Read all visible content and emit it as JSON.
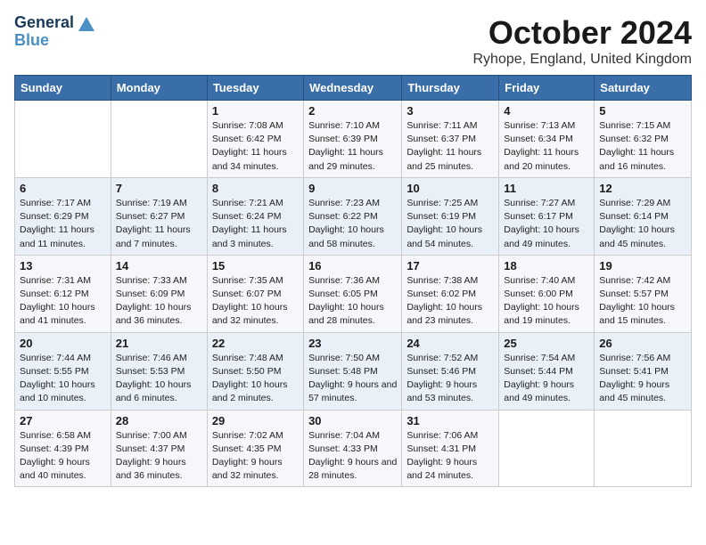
{
  "logo": {
    "line1": "General",
    "line2": "Blue"
  },
  "title": "October 2024",
  "location": "Ryhope, England, United Kingdom",
  "days_of_week": [
    "Sunday",
    "Monday",
    "Tuesday",
    "Wednesday",
    "Thursday",
    "Friday",
    "Saturday"
  ],
  "weeks": [
    [
      {
        "day": "",
        "info": ""
      },
      {
        "day": "",
        "info": ""
      },
      {
        "day": "1",
        "info": "Sunrise: 7:08 AM\nSunset: 6:42 PM\nDaylight: 11 hours and 34 minutes."
      },
      {
        "day": "2",
        "info": "Sunrise: 7:10 AM\nSunset: 6:39 PM\nDaylight: 11 hours and 29 minutes."
      },
      {
        "day": "3",
        "info": "Sunrise: 7:11 AM\nSunset: 6:37 PM\nDaylight: 11 hours and 25 minutes."
      },
      {
        "day": "4",
        "info": "Sunrise: 7:13 AM\nSunset: 6:34 PM\nDaylight: 11 hours and 20 minutes."
      },
      {
        "day": "5",
        "info": "Sunrise: 7:15 AM\nSunset: 6:32 PM\nDaylight: 11 hours and 16 minutes."
      }
    ],
    [
      {
        "day": "6",
        "info": "Sunrise: 7:17 AM\nSunset: 6:29 PM\nDaylight: 11 hours and 11 minutes."
      },
      {
        "day": "7",
        "info": "Sunrise: 7:19 AM\nSunset: 6:27 PM\nDaylight: 11 hours and 7 minutes."
      },
      {
        "day": "8",
        "info": "Sunrise: 7:21 AM\nSunset: 6:24 PM\nDaylight: 11 hours and 3 minutes."
      },
      {
        "day": "9",
        "info": "Sunrise: 7:23 AM\nSunset: 6:22 PM\nDaylight: 10 hours and 58 minutes."
      },
      {
        "day": "10",
        "info": "Sunrise: 7:25 AM\nSunset: 6:19 PM\nDaylight: 10 hours and 54 minutes."
      },
      {
        "day": "11",
        "info": "Sunrise: 7:27 AM\nSunset: 6:17 PM\nDaylight: 10 hours and 49 minutes."
      },
      {
        "day": "12",
        "info": "Sunrise: 7:29 AM\nSunset: 6:14 PM\nDaylight: 10 hours and 45 minutes."
      }
    ],
    [
      {
        "day": "13",
        "info": "Sunrise: 7:31 AM\nSunset: 6:12 PM\nDaylight: 10 hours and 41 minutes."
      },
      {
        "day": "14",
        "info": "Sunrise: 7:33 AM\nSunset: 6:09 PM\nDaylight: 10 hours and 36 minutes."
      },
      {
        "day": "15",
        "info": "Sunrise: 7:35 AM\nSunset: 6:07 PM\nDaylight: 10 hours and 32 minutes."
      },
      {
        "day": "16",
        "info": "Sunrise: 7:36 AM\nSunset: 6:05 PM\nDaylight: 10 hours and 28 minutes."
      },
      {
        "day": "17",
        "info": "Sunrise: 7:38 AM\nSunset: 6:02 PM\nDaylight: 10 hours and 23 minutes."
      },
      {
        "day": "18",
        "info": "Sunrise: 7:40 AM\nSunset: 6:00 PM\nDaylight: 10 hours and 19 minutes."
      },
      {
        "day": "19",
        "info": "Sunrise: 7:42 AM\nSunset: 5:57 PM\nDaylight: 10 hours and 15 minutes."
      }
    ],
    [
      {
        "day": "20",
        "info": "Sunrise: 7:44 AM\nSunset: 5:55 PM\nDaylight: 10 hours and 10 minutes."
      },
      {
        "day": "21",
        "info": "Sunrise: 7:46 AM\nSunset: 5:53 PM\nDaylight: 10 hours and 6 minutes."
      },
      {
        "day": "22",
        "info": "Sunrise: 7:48 AM\nSunset: 5:50 PM\nDaylight: 10 hours and 2 minutes."
      },
      {
        "day": "23",
        "info": "Sunrise: 7:50 AM\nSunset: 5:48 PM\nDaylight: 9 hours and 57 minutes."
      },
      {
        "day": "24",
        "info": "Sunrise: 7:52 AM\nSunset: 5:46 PM\nDaylight: 9 hours and 53 minutes."
      },
      {
        "day": "25",
        "info": "Sunrise: 7:54 AM\nSunset: 5:44 PM\nDaylight: 9 hours and 49 minutes."
      },
      {
        "day": "26",
        "info": "Sunrise: 7:56 AM\nSunset: 5:41 PM\nDaylight: 9 hours and 45 minutes."
      }
    ],
    [
      {
        "day": "27",
        "info": "Sunrise: 6:58 AM\nSunset: 4:39 PM\nDaylight: 9 hours and 40 minutes."
      },
      {
        "day": "28",
        "info": "Sunrise: 7:00 AM\nSunset: 4:37 PM\nDaylight: 9 hours and 36 minutes."
      },
      {
        "day": "29",
        "info": "Sunrise: 7:02 AM\nSunset: 4:35 PM\nDaylight: 9 hours and 32 minutes."
      },
      {
        "day": "30",
        "info": "Sunrise: 7:04 AM\nSunset: 4:33 PM\nDaylight: 9 hours and 28 minutes."
      },
      {
        "day": "31",
        "info": "Sunrise: 7:06 AM\nSunset: 4:31 PM\nDaylight: 9 hours and 24 minutes."
      },
      {
        "day": "",
        "info": ""
      },
      {
        "day": "",
        "info": ""
      }
    ]
  ]
}
